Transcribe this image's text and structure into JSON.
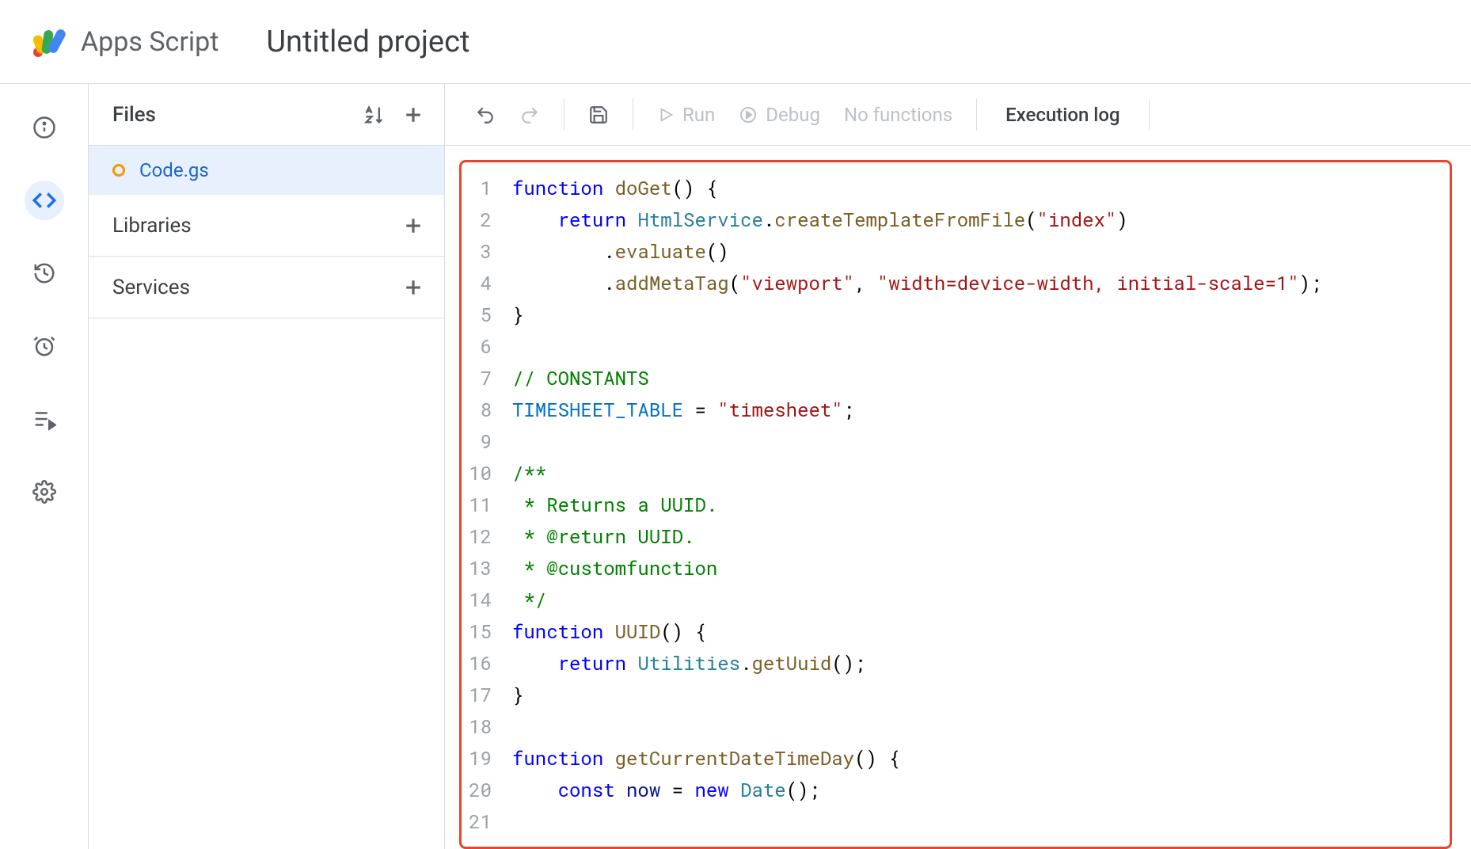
{
  "header": {
    "app_name": "Apps Script",
    "project_title": "Untitled project"
  },
  "nav_rail": {
    "items": [
      {
        "name": "overview",
        "icon": "info"
      },
      {
        "name": "editor",
        "icon": "code",
        "active": true
      },
      {
        "name": "history",
        "icon": "history"
      },
      {
        "name": "triggers",
        "icon": "alarm"
      },
      {
        "name": "executions",
        "icon": "playlist-play"
      },
      {
        "name": "settings",
        "icon": "gear"
      }
    ]
  },
  "sidebar": {
    "files_label": "Files",
    "libraries_label": "Libraries",
    "services_label": "Services",
    "files": [
      {
        "name": "Code.gs",
        "modified": true,
        "active": true
      }
    ]
  },
  "toolbar": {
    "run_label": "Run",
    "debug_label": "Debug",
    "no_functions_label": "No functions",
    "execution_log_label": "Execution log"
  },
  "editor": {
    "line_start": 1,
    "line_end": 21,
    "code_plain": "function doGet() {\n    return HtmlService.createTemplateFromFile(\"index\")\n        .evaluate()\n        .addMetaTag(\"viewport\", \"width=device-width, initial-scale=1\");\n}\n\n// CONSTANTS\nTIMESHEET_TABLE = \"timesheet\";\n\n/**\n * Returns a UUID.\n * @return UUID.\n * @customfunction\n */\nfunction UUID() {\n    return Utilities.getUuid();\n}\n\nfunction getCurrentDateTimeDay() {\n    const now = new Date();\n",
    "tokens": [
      [
        [
          "kw",
          "function"
        ],
        [
          "sp",
          " "
        ],
        [
          "fn",
          "doGet"
        ],
        [
          "op",
          "("
        ],
        [
          "op",
          ") {"
        ]
      ],
      [
        [
          "sp",
          "    "
        ],
        [
          "kw",
          "return"
        ],
        [
          "sp",
          " "
        ],
        [
          "cls",
          "HtmlService"
        ],
        [
          "op",
          "."
        ],
        [
          "fn",
          "createTemplateFromFile"
        ],
        [
          "op",
          "("
        ],
        [
          "str",
          "\"index\""
        ],
        [
          "op",
          ")"
        ]
      ],
      [
        [
          "sp",
          "        "
        ],
        [
          "op",
          "."
        ],
        [
          "fn",
          "evaluate"
        ],
        [
          "op",
          "()"
        ]
      ],
      [
        [
          "sp",
          "        "
        ],
        [
          "op",
          "."
        ],
        [
          "fn",
          "addMetaTag"
        ],
        [
          "op",
          "("
        ],
        [
          "str",
          "\"viewport\""
        ],
        [
          "op",
          ", "
        ],
        [
          "str",
          "\"width=device-width, initial-scale=1\""
        ],
        [
          "op",
          ");"
        ]
      ],
      [
        [
          "op",
          "}"
        ]
      ],
      [],
      [
        [
          "com",
          "// CONSTANTS"
        ]
      ],
      [
        [
          "const",
          "TIMESHEET_TABLE"
        ],
        [
          "op",
          " = "
        ],
        [
          "str",
          "\"timesheet\""
        ],
        [
          "op",
          ";"
        ]
      ],
      [],
      [
        [
          "com",
          "/**"
        ]
      ],
      [
        [
          "com",
          " * Returns a UUID."
        ]
      ],
      [
        [
          "com",
          " * @return UUID."
        ]
      ],
      [
        [
          "com",
          " * @customfunction"
        ]
      ],
      [
        [
          "com",
          " */"
        ]
      ],
      [
        [
          "kw",
          "function"
        ],
        [
          "sp",
          " "
        ],
        [
          "fn",
          "UUID"
        ],
        [
          "op",
          "() {"
        ]
      ],
      [
        [
          "sp",
          "    "
        ],
        [
          "kw",
          "return"
        ],
        [
          "sp",
          " "
        ],
        [
          "cls",
          "Utilities"
        ],
        [
          "op",
          "."
        ],
        [
          "fn",
          "getUuid"
        ],
        [
          "op",
          "();"
        ]
      ],
      [
        [
          "op",
          "}"
        ]
      ],
      [],
      [
        [
          "kw",
          "function"
        ],
        [
          "sp",
          " "
        ],
        [
          "fn",
          "getCurrentDateTimeDay"
        ],
        [
          "op",
          "() {"
        ]
      ],
      [
        [
          "sp",
          "    "
        ],
        [
          "kw",
          "const"
        ],
        [
          "sp",
          " "
        ],
        [
          "id",
          "now"
        ],
        [
          "op",
          " = "
        ],
        [
          "kw",
          "new"
        ],
        [
          "sp",
          " "
        ],
        [
          "cls",
          "Date"
        ],
        [
          "op",
          "();"
        ]
      ],
      []
    ]
  }
}
